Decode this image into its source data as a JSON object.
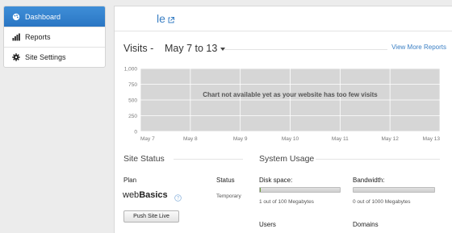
{
  "sidebar": {
    "items": [
      {
        "label": "Dashboard",
        "icon": "palette-icon",
        "active": true
      },
      {
        "label": "Reports",
        "icon": "bar-chart-icon",
        "active": false
      },
      {
        "label": "Site Settings",
        "icon": "gear-icon",
        "active": false
      }
    ]
  },
  "header": {
    "site_name": "le",
    "icon": "external-link-icon"
  },
  "visits": {
    "label": "Visits -",
    "range": "May 7 to 13",
    "view_more": "View More Reports",
    "chart_message": "Chart not available yet as your website has too few visits"
  },
  "chart_data": {
    "type": "line",
    "title": "",
    "xlabel": "",
    "ylabel": "",
    "categories": [
      "May 7",
      "May 8",
      "May 9",
      "May 10",
      "May 11",
      "May 12",
      "May 13"
    ],
    "y_ticks": [
      "1,000",
      "750",
      "500",
      "250",
      "0"
    ],
    "ylim": [
      0,
      1000
    ],
    "series": [],
    "grid": true,
    "colors": {
      "plot_bg": "#d6d6d6",
      "grid": "#ffffff",
      "axis_text": "#777777"
    }
  },
  "site_status": {
    "title": "Site Status",
    "plan_label": "Plan",
    "plan_name_prefix": "web",
    "plan_name_bold": "Basics",
    "status_label": "Status",
    "status_value": "Temporary",
    "push_button": "Push Site Live"
  },
  "system_usage": {
    "title": "System Usage",
    "disk_label": "Disk space:",
    "disk_value": "1 out of 100 Megabytes",
    "disk_fraction": 0.01,
    "bandwidth_label": "Bandwidth:",
    "bandwidth_value": "0 out of 1000 Megabytes",
    "bandwidth_fraction": 0.0,
    "users_label": "Users",
    "domains_label": "Domains"
  },
  "colors": {
    "accent": "#2f7fcb",
    "link": "#3a7fc4",
    "usage_fill": "#6a9a3a"
  }
}
